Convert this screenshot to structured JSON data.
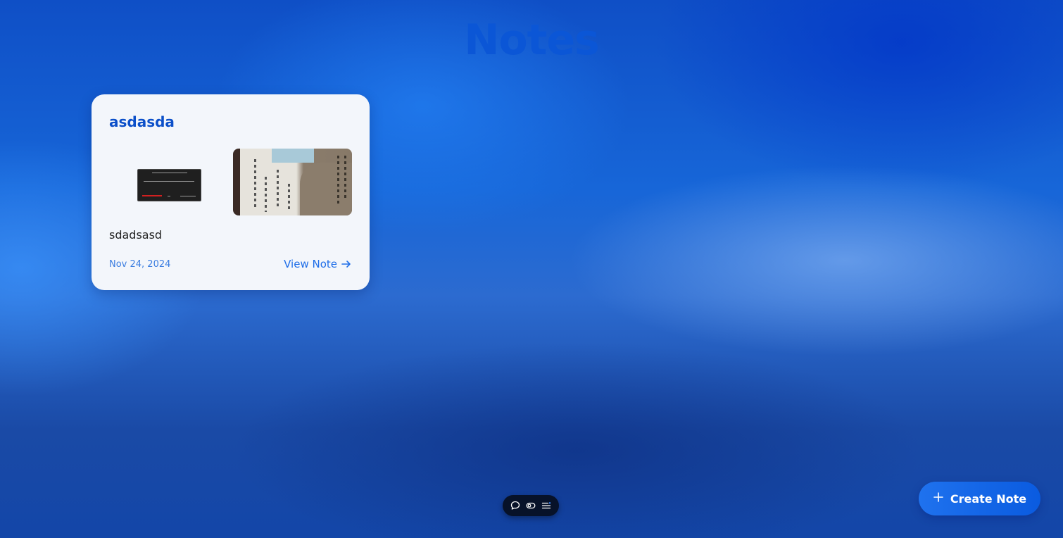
{
  "header": {
    "title": "Notes"
  },
  "notes": [
    {
      "title": "asdasda",
      "body": "sdadsasd",
      "date": "Nov 24, 2024",
      "view_label": "View Note",
      "attachments": [
        "terminal-screenshot",
        "document-photo"
      ]
    }
  ],
  "toolbar": {
    "icons": [
      "chat-bubble-icon",
      "toggle-icon",
      "menu-list-icon"
    ]
  },
  "actions": {
    "create_label": "Create Note"
  },
  "colors": {
    "accent": "#0b56d6",
    "card_background": "#f3f6fb",
    "toolbar_background": "#071229",
    "create_button": "#1f72ee"
  }
}
